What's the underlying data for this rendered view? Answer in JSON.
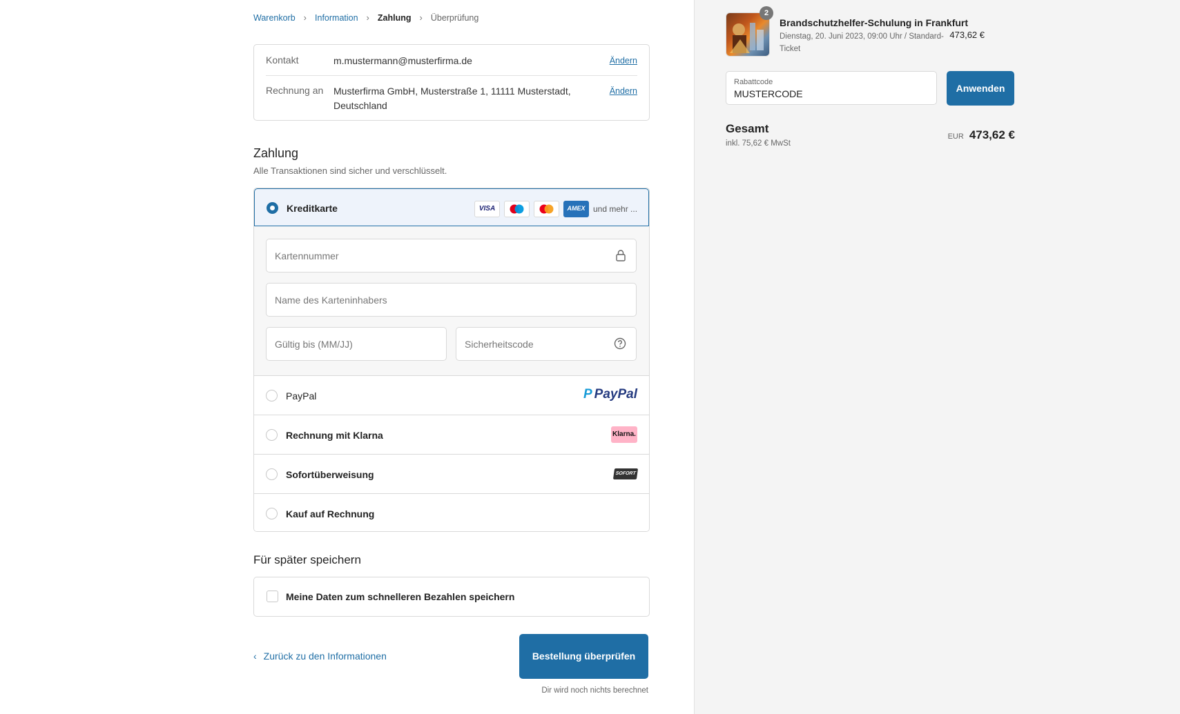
{
  "breadcrumb": {
    "cart": "Warenkorb",
    "information": "Information",
    "payment": "Zahlung",
    "review": "Überprüfung"
  },
  "review": {
    "contact_label": "Kontakt",
    "contact_value": "m.mustermann@musterfirma.de",
    "billing_label": "Rechnung an",
    "billing_value": "Musterfirma GmbH, Musterstraße 1, 11111 Musterstadt, Deutschland",
    "change_label": "Ändern"
  },
  "payment": {
    "title": "Zahlung",
    "subtitle": "Alle Transaktionen sind sicher und verschlüsselt.",
    "credit_card": {
      "label": "Kreditkarte",
      "more": "und mehr ...",
      "card_number_placeholder": "Kartennummer",
      "holder_placeholder": "Name des Karteninhabers",
      "expiry_placeholder": "Gültig bis (MM/JJ)",
      "cvc_placeholder": "Sicherheitscode",
      "badges": {
        "visa": "VISA",
        "amex": "AMEX"
      }
    },
    "methods": [
      {
        "label": "PayPal",
        "logo": "PayPal",
        "logo_p": "P"
      },
      {
        "label": "Rechnung mit Klarna",
        "logo": "Klarna."
      },
      {
        "label": "Sofortüberweisung",
        "logo": "SOFORT"
      },
      {
        "label": "Kauf auf Rechnung"
      }
    ]
  },
  "save": {
    "title": "Für später speichern",
    "checkbox_label": "Meine Daten zum schnelleren Bezahlen speichern"
  },
  "footer": {
    "back_label": "Zurück zu den Informationen",
    "review_button": "Bestellung überprüfen",
    "note": "Dir wird noch nichts berechnet"
  },
  "summary": {
    "item": {
      "quantity": "2",
      "title": "Brandschutzhelfer-Schulung in Frankfurt",
      "details": "Dienstag, 20. Juni 2023, 09:00 Uhr / Standard-Ticket",
      "price": "473,62 €"
    },
    "discount": {
      "label": "Rabattcode",
      "value": "MUSTERCODE",
      "button": "Anwenden"
    },
    "total_label": "Gesamt",
    "tax_note": "inkl. 75,62 € MwSt",
    "currency": "EUR",
    "total_value": "473,62 €"
  },
  "colors": {
    "accent": "#1f6ea5",
    "selected_bg": "#eef3fb",
    "klarna": "#ffb3c7",
    "sidebar_bg": "#f4f4f4"
  }
}
